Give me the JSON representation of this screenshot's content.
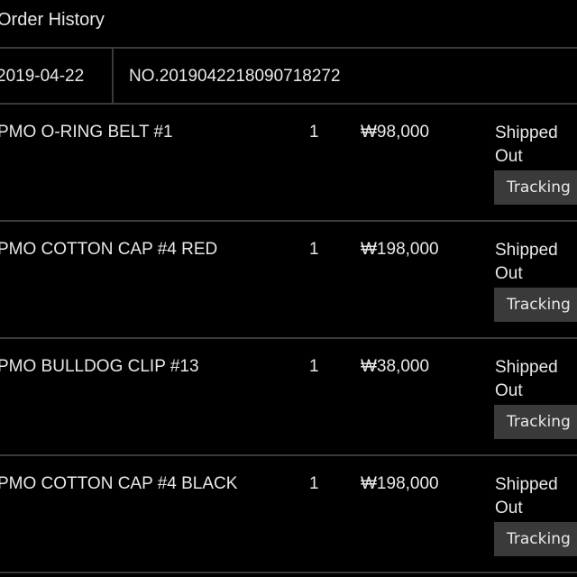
{
  "header": {
    "title": "Order History"
  },
  "order": {
    "date": "2019-04-22",
    "number": "NO.2019042218090718272"
  },
  "items": [
    {
      "name": "PMO O-RING BELT #1",
      "qty": "1",
      "price": "₩98,000",
      "status": "Shipped Out",
      "action": "Tracking"
    },
    {
      "name": "PMO COTTON CAP #4 RED",
      "qty": "1",
      "price": "₩198,000",
      "status": "Shipped Out",
      "action": "Tracking"
    },
    {
      "name": "PMO BULLDOG CLIP #13",
      "qty": "1",
      "price": "₩38,000",
      "status": "Shipped Out",
      "action": "Tracking"
    },
    {
      "name": "PMO COTTON CAP #4 BLACK",
      "qty": "1",
      "price": "₩198,000",
      "status": "Shipped Out",
      "action": "Tracking"
    }
  ]
}
